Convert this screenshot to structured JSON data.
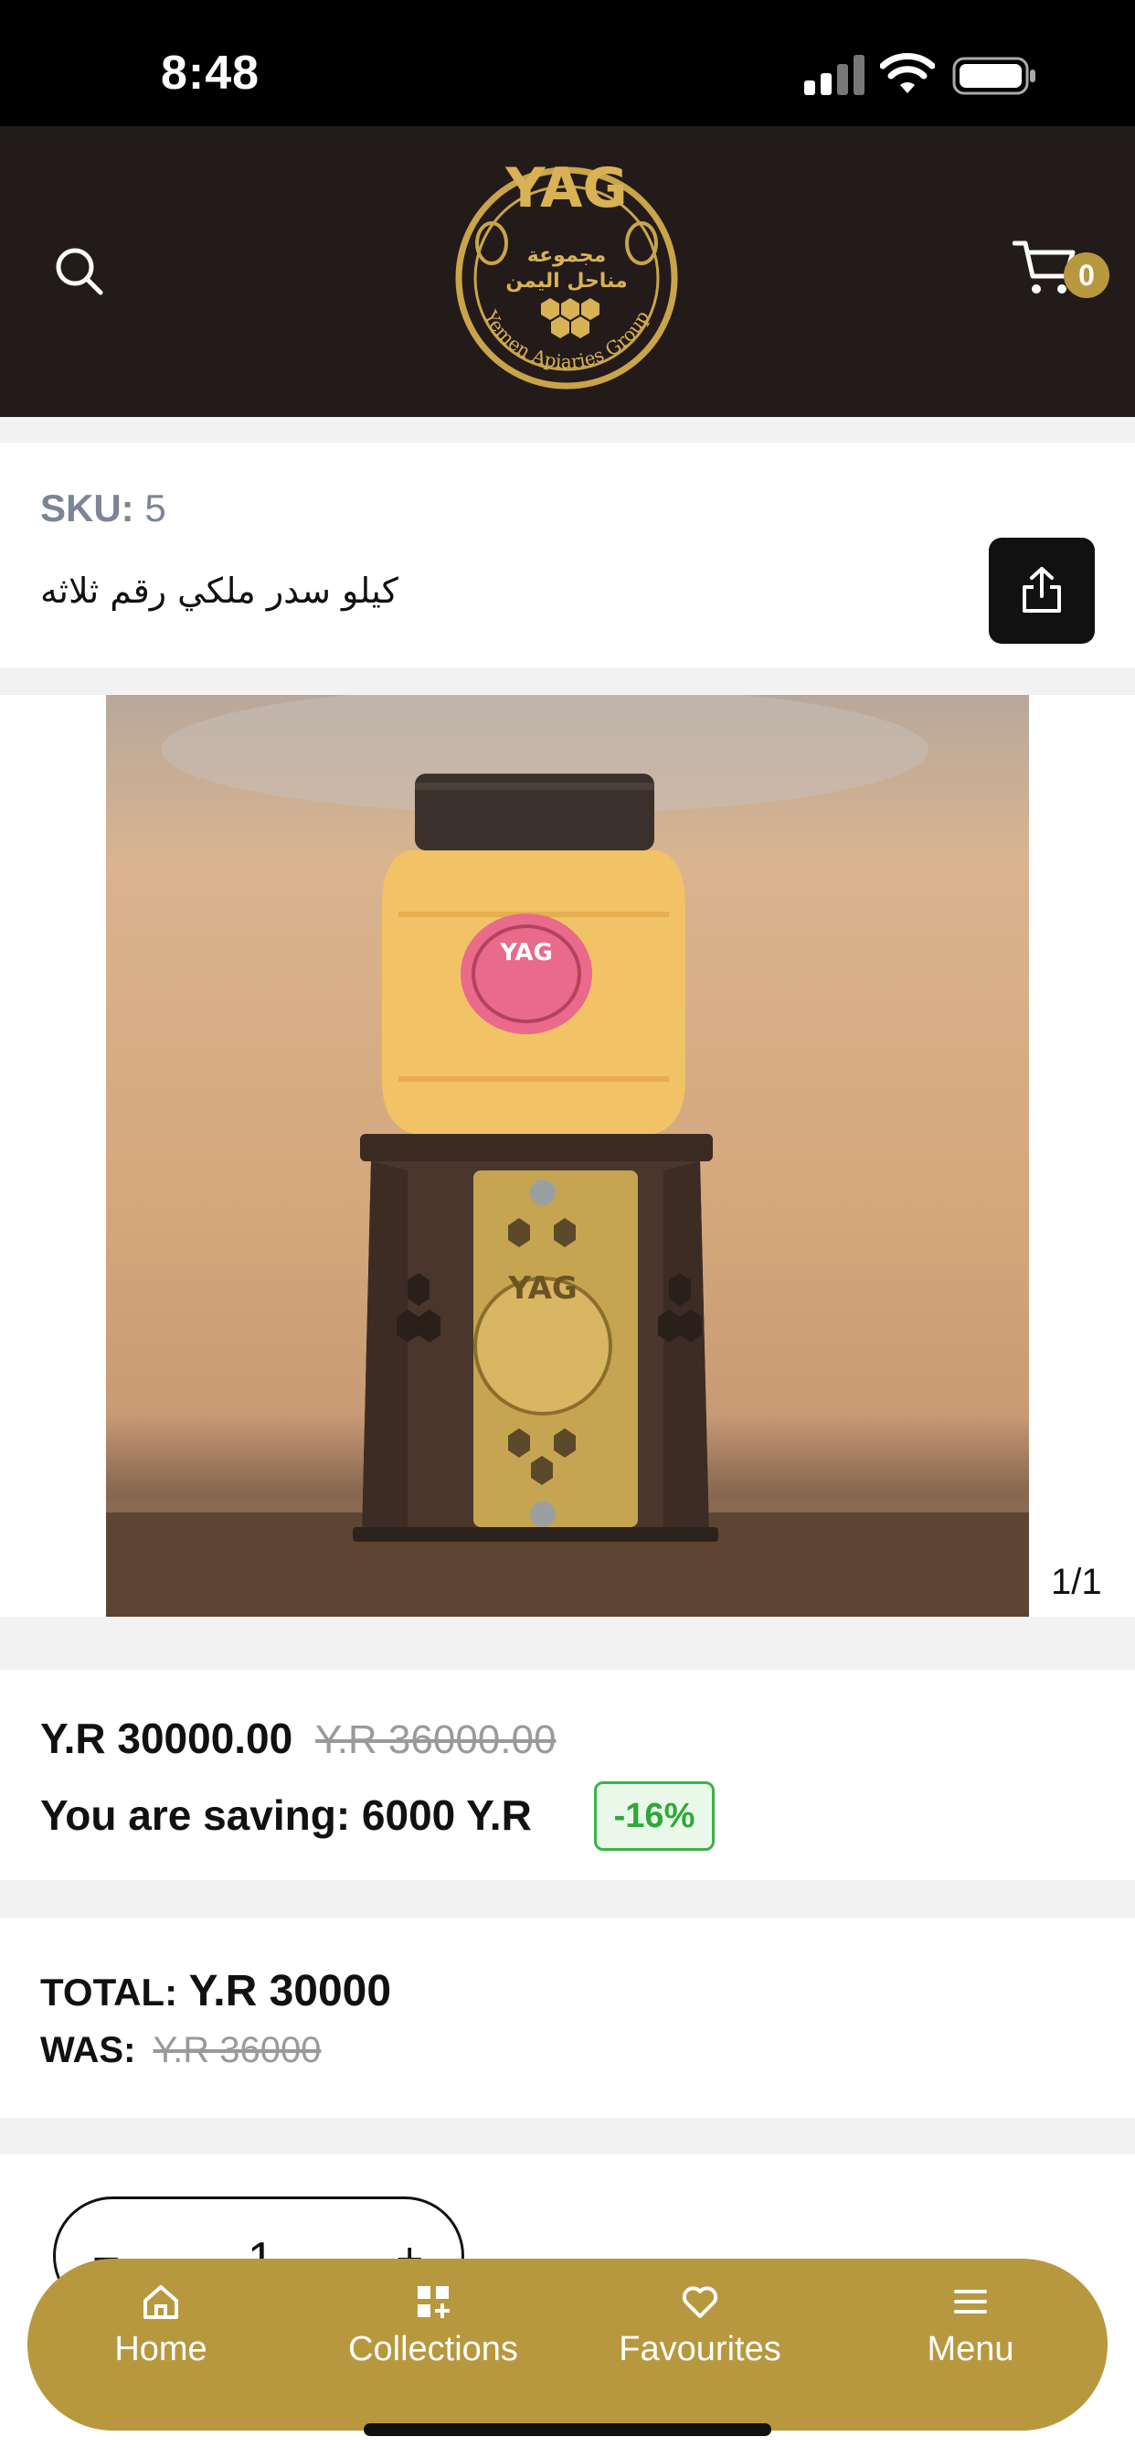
{
  "status_bar": {
    "time": "8:48"
  },
  "header": {
    "logo_text": "YAG",
    "logo_arabic": "مجموعة مناحل اليمن",
    "logo_english": "Yemen Apiaries Group",
    "cart_count": "0",
    "brand_color": "#b8983f",
    "bar_color": "#231b1a"
  },
  "product": {
    "sku_label": "SKU:",
    "sku_value": "5",
    "name": "كيلو سدر ملكي رقم ثلاثه",
    "gallery_counter": "1/1"
  },
  "pricing": {
    "price": "Y.R 30000.00",
    "old_price": "Y.R 36000.00",
    "saving_label": "You are saving:",
    "saving_value": "6000 Y.R",
    "discount_badge": "-16%"
  },
  "totals": {
    "total_label": "TOTAL:",
    "total_value": "Y.R 30000",
    "was_label": "WAS:",
    "was_value": "Y.R 36000"
  },
  "quantity": {
    "minus": "−",
    "value": "1",
    "plus": "+"
  },
  "tabbar": {
    "home": "Home",
    "collections": "Collections",
    "favourites": "Favourites",
    "menu": "Menu"
  }
}
